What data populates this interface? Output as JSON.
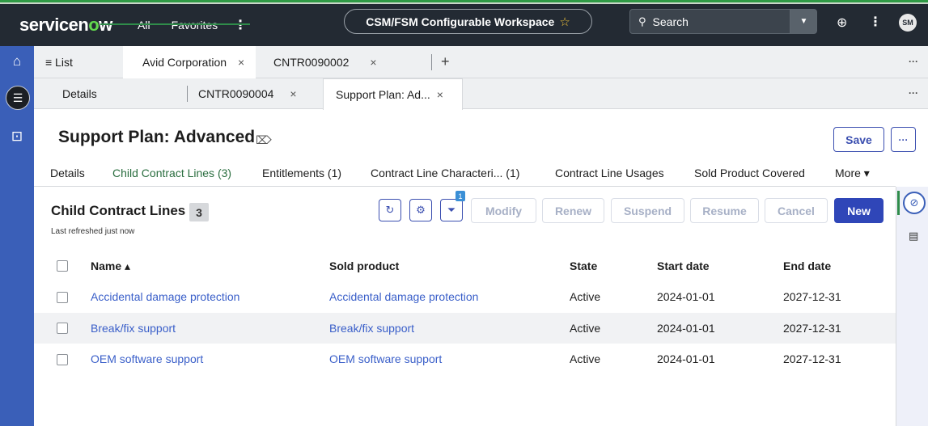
{
  "header": {
    "logo_pre": "servicen",
    "logo_o": "o",
    "logo_post": "w",
    "nav_all": "All",
    "nav_favorites": "Favorites",
    "nav_more": "⋮",
    "workspace": "CSM/FSM Configurable Workspace",
    "search_placeholder": "Search",
    "avatar_initials": "SM"
  },
  "tabs_primary": [
    {
      "label": "≡ List"
    },
    {
      "label": "Avid Corporation"
    },
    {
      "label": "CNTR0090002"
    }
  ],
  "tabs_secondary": [
    {
      "label": "Details"
    },
    {
      "label": "CNTR0090004"
    },
    {
      "label": "Support Plan: Ad..."
    }
  ],
  "record": {
    "title": "Support Plan: Advanced",
    "save_label": "Save",
    "more_label": "···"
  },
  "related_tabs": [
    {
      "label": "Details"
    },
    {
      "label": "Child Contract Lines (3)"
    },
    {
      "label": "Entitlements (1)"
    },
    {
      "label": "Contract Line Characteri... (1)"
    },
    {
      "label": "Contract Line Usages"
    },
    {
      "label": "Sold Product Covered"
    },
    {
      "label": "More ▾"
    }
  ],
  "list": {
    "title": "Child Contract Lines",
    "count": "3",
    "refreshed": "Last refreshed just now",
    "filter_count": "1",
    "actions": {
      "modify": "Modify",
      "renew": "Renew",
      "suspend": "Suspend",
      "resume": "Resume",
      "cancel": "Cancel",
      "new": "New"
    },
    "columns": {
      "name": "Name ▴",
      "sold_product": "Sold product",
      "state": "State",
      "start_date": "Start date",
      "end_date": "End date"
    },
    "rows": [
      {
        "name": "Accidental damage protection",
        "sold_product": "Accidental damage protection",
        "state": "Active",
        "start_date": "2024-01-01",
        "end_date": "2027-12-31"
      },
      {
        "name": "Break/fix support",
        "sold_product": "Break/fix support",
        "state": "Active",
        "start_date": "2024-01-01",
        "end_date": "2027-12-31"
      },
      {
        "name": "OEM software support",
        "sold_product": "OEM software support",
        "state": "Active",
        "start_date": "2024-01-01",
        "end_date": "2027-12-31"
      }
    ]
  },
  "colors": {
    "header_bg": "#232a33",
    "rail_bg": "#3a5fb8",
    "primary": "#2f46b8",
    "link": "#3a5fc9",
    "active_tab": "#2f8c4a"
  },
  "icons": {
    "rail": [
      "home-icon",
      "list-icon",
      "inbox-icon"
    ],
    "toolbar": [
      "refresh-icon",
      "settings-icon",
      "filter-icon"
    ],
    "side": [
      "attachment-icon",
      "document-icon"
    ]
  }
}
